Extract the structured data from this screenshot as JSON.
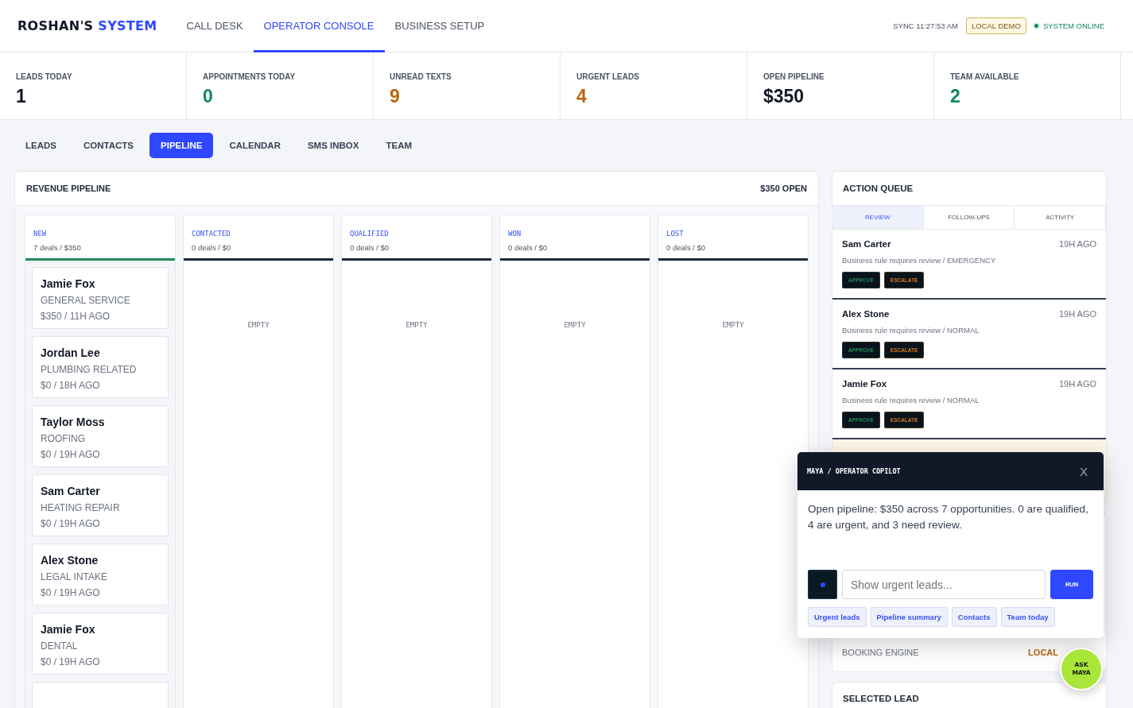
{
  "header": {
    "brand": "ROSHAN'S",
    "brand_accent": "SYSTEM",
    "nav": [
      {
        "label": "CALL DESK",
        "selected": false
      },
      {
        "label": "OPERATOR CONSOLE",
        "selected": true
      },
      {
        "label": "BUSINESS SETUP",
        "selected": false
      }
    ],
    "sync": "SYNC 11:27:53 AM",
    "mode_badge": "LOCAL DEMO",
    "status": "SYSTEM ONLINE"
  },
  "stats": [
    {
      "label": "LEADS TODAY",
      "value": "1",
      "color": "#111827"
    },
    {
      "label": "APPOINTMENTS TODAY",
      "value": "0",
      "color": "#0f8a5f"
    },
    {
      "label": "UNREAD TEXTS",
      "value": "9",
      "color": "#b8670b"
    },
    {
      "label": "URGENT LEADS",
      "value": "4",
      "color": "#b8670b"
    },
    {
      "label": "OPEN PIPELINE",
      "value": "$350",
      "color": "#111827"
    },
    {
      "label": "TEAM AVAILABLE",
      "value": "2",
      "color": "#0f8a5f"
    }
  ],
  "tabs": [
    {
      "label": "LEADS",
      "selected": false
    },
    {
      "label": "CONTACTS",
      "selected": false
    },
    {
      "label": "PIPELINE",
      "selected": true
    },
    {
      "label": "CALENDAR",
      "selected": false
    },
    {
      "label": "SMS INBOX",
      "selected": false
    },
    {
      "label": "TEAM",
      "selected": false
    }
  ],
  "pipeline": {
    "title": "REVENUE PIPELINE",
    "total": "$350 OPEN",
    "stages": [
      {
        "name": "NEW",
        "summary": "7 deals / $350",
        "color": "#1f8a5a",
        "deals": [
          {
            "name": "Jamie Fox",
            "service": "GENERAL SERVICE",
            "meta": "$350 / 11H AGO"
          },
          {
            "name": "Jordan Lee",
            "service": "PLUMBING RELATED",
            "meta": "$0 / 18H AGO"
          },
          {
            "name": "Taylor Moss",
            "service": "ROOFING",
            "meta": "$0 / 19H AGO"
          },
          {
            "name": "Sam Carter",
            "service": "HEATING REPAIR",
            "meta": "$0 / 19H AGO"
          },
          {
            "name": "Alex Stone",
            "service": "LEGAL INTAKE",
            "meta": "$0 / 19H AGO"
          },
          {
            "name": "Jamie Fox",
            "service": "DENTAL",
            "meta": "$0 / 19H AGO"
          }
        ]
      },
      {
        "name": "CONTACTED",
        "summary": "0 deals / $0",
        "color": "#1e293b",
        "empty": "EMPTY"
      },
      {
        "name": "QUALIFIED",
        "summary": "0 deals / $0",
        "color": "#1e293b",
        "empty": "EMPTY"
      },
      {
        "name": "WON",
        "summary": "0 deals / $0",
        "color": "#1e293b",
        "empty": "EMPTY"
      },
      {
        "name": "LOST",
        "summary": "0 deals / $0",
        "color": "#1e293b",
        "empty": "EMPTY"
      }
    ]
  },
  "action_queue": {
    "title": "ACTION QUEUE",
    "tabs": [
      {
        "label": "REVIEW",
        "selected": true
      },
      {
        "label": "FOLLOW-UPS",
        "selected": false
      },
      {
        "label": "ACTIVITY",
        "selected": false
      }
    ],
    "items": [
      {
        "name": "Sam Carter",
        "time": "19H AGO",
        "reason": "Business rule requires review / EMERGENCY",
        "approve": "APPROVE",
        "escalate": "ESCALATE"
      },
      {
        "name": "Alex Stone",
        "time": "19H AGO",
        "reason": "Business rule requires review / NORMAL",
        "approve": "APPROVE",
        "escalate": "ESCALATE"
      },
      {
        "name": "Jamie Fox",
        "time": "19H AGO",
        "reason": "Business rule requires review / NORMAL",
        "approve": "APPROVE",
        "escalate": "ESCALATE"
      }
    ]
  },
  "booking": {
    "label": "BOOKING ENGINE",
    "value": "LOCAL"
  },
  "selected_lead": {
    "title": "SELECTED LEAD"
  },
  "copilot": {
    "title": "MAYA / OPERATOR COPILOT",
    "close": "X",
    "message": "Open pipeline: $350 across 7 opportunities. 0 are qualified, 4 are urgent, and 3 need review.",
    "placeholder": "Show urgent leads...",
    "run": "RUN",
    "suggestions": [
      "Urgent leads",
      "Pipeline summary",
      "Contacts",
      "Team today"
    ],
    "fab": "ASK MAYA"
  }
}
